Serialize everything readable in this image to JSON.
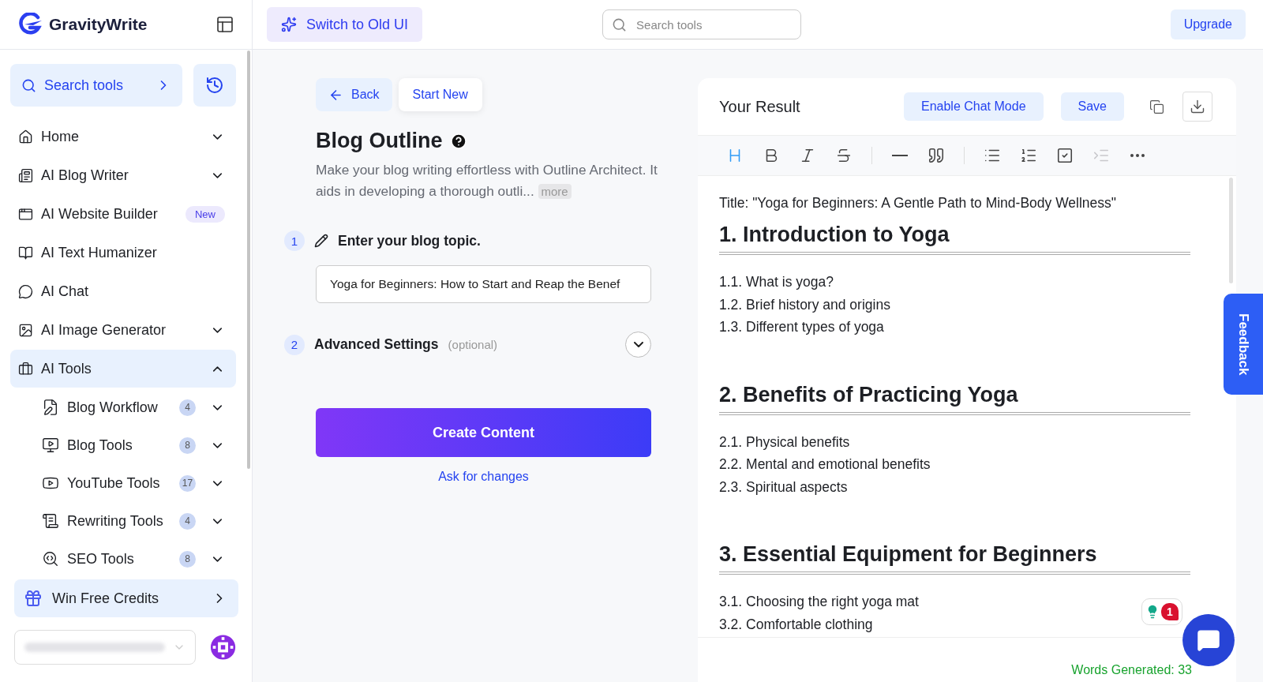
{
  "brand": {
    "name": "GravityWrite"
  },
  "sidebar": {
    "search_label": "Search tools",
    "items": [
      {
        "label": "Home",
        "kind": "group",
        "expanded": false,
        "selected": false
      },
      {
        "label": "AI Blog Writer",
        "kind": "group",
        "expanded": false,
        "selected": false
      },
      {
        "label": "AI Website Builder",
        "kind": "link",
        "badge": "New",
        "selected": false
      },
      {
        "label": "AI Text Humanizer",
        "kind": "link",
        "selected": false
      },
      {
        "label": "AI Chat",
        "kind": "link",
        "selected": false
      },
      {
        "label": "AI Image Generator",
        "kind": "group",
        "expanded": false,
        "selected": false
      },
      {
        "label": "AI Tools",
        "kind": "group",
        "expanded": true,
        "selected": true,
        "children": [
          {
            "label": "Blog Workflow",
            "count": "4",
            "expanded": false
          },
          {
            "label": "Blog Tools",
            "count": "8",
            "expanded": false
          },
          {
            "label": "YouTube Tools",
            "count": "17",
            "expanded": false
          },
          {
            "label": "Rewriting Tools",
            "count": "4",
            "expanded": false
          },
          {
            "label": "SEO Tools",
            "count": "8",
            "expanded": false
          }
        ]
      }
    ],
    "promo": "Win Free Credits"
  },
  "header": {
    "switch_button": "Switch to Old UI",
    "search": {
      "placeholder": "Search tools"
    },
    "upgrade": "Upgrade"
  },
  "form": {
    "back": "Back",
    "start_new": "Start New",
    "title": "Blog Outline",
    "description": "Make your blog writing effortless with Outline Architect. It aids in developing a thorough outli...",
    "more": "more",
    "steps": [
      {
        "number": "1",
        "kind": "input",
        "label": "Enter your blog topic.",
        "value": "Yoga for Beginners: How to Start and Reap the Benef"
      },
      {
        "number": "2",
        "kind": "collapsible",
        "label": "Advanced Settings",
        "hint": "(optional)",
        "expanded": false
      }
    ],
    "submit": "Create Content",
    "ask": "Ask for changes"
  },
  "result": {
    "title": "Your Result",
    "chat_mode": "Enable Chat Mode",
    "save": "Save",
    "toolbar": [
      {
        "kind": "heading",
        "active": true,
        "disabled": false
      },
      {
        "kind": "bold",
        "active": false,
        "disabled": false
      },
      {
        "kind": "italic",
        "active": false,
        "disabled": false
      },
      {
        "kind": "strike",
        "active": false,
        "disabled": false
      },
      {
        "kind": "separator"
      },
      {
        "kind": "rule",
        "active": false,
        "disabled": false
      },
      {
        "kind": "quote",
        "active": false,
        "disabled": false
      },
      {
        "kind": "separator"
      },
      {
        "kind": "bullets",
        "active": false,
        "disabled": false
      },
      {
        "kind": "numbers",
        "active": false,
        "disabled": false
      },
      {
        "kind": "task",
        "active": false,
        "disabled": false
      },
      {
        "kind": "indent",
        "active": false,
        "disabled": true
      },
      {
        "kind": "more",
        "active": false,
        "disabled": false
      }
    ],
    "doc_title": "Title: \"Yoga for Beginners: A Gentle Path to Mind-Body Wellness\"",
    "sections": [
      {
        "heading": "1. Introduction to Yoga",
        "items": [
          "1.1. What is yoga?",
          "1.2. Brief history and origins",
          "1.3. Different types of yoga"
        ]
      },
      {
        "heading": "2. Benefits of Practicing Yoga",
        "items": [
          "2.1. Physical benefits",
          "2.2. Mental and emotional benefits",
          "2.3. Spiritual aspects"
        ]
      },
      {
        "heading": "3. Essential Equipment for Beginners",
        "items": [
          "3.1. Choosing the right yoga mat",
          "3.2. Comfortable clothing"
        ]
      }
    ],
    "words": "Words Generated: 33",
    "assistant_count": "1"
  },
  "feedback": "Feedback"
}
